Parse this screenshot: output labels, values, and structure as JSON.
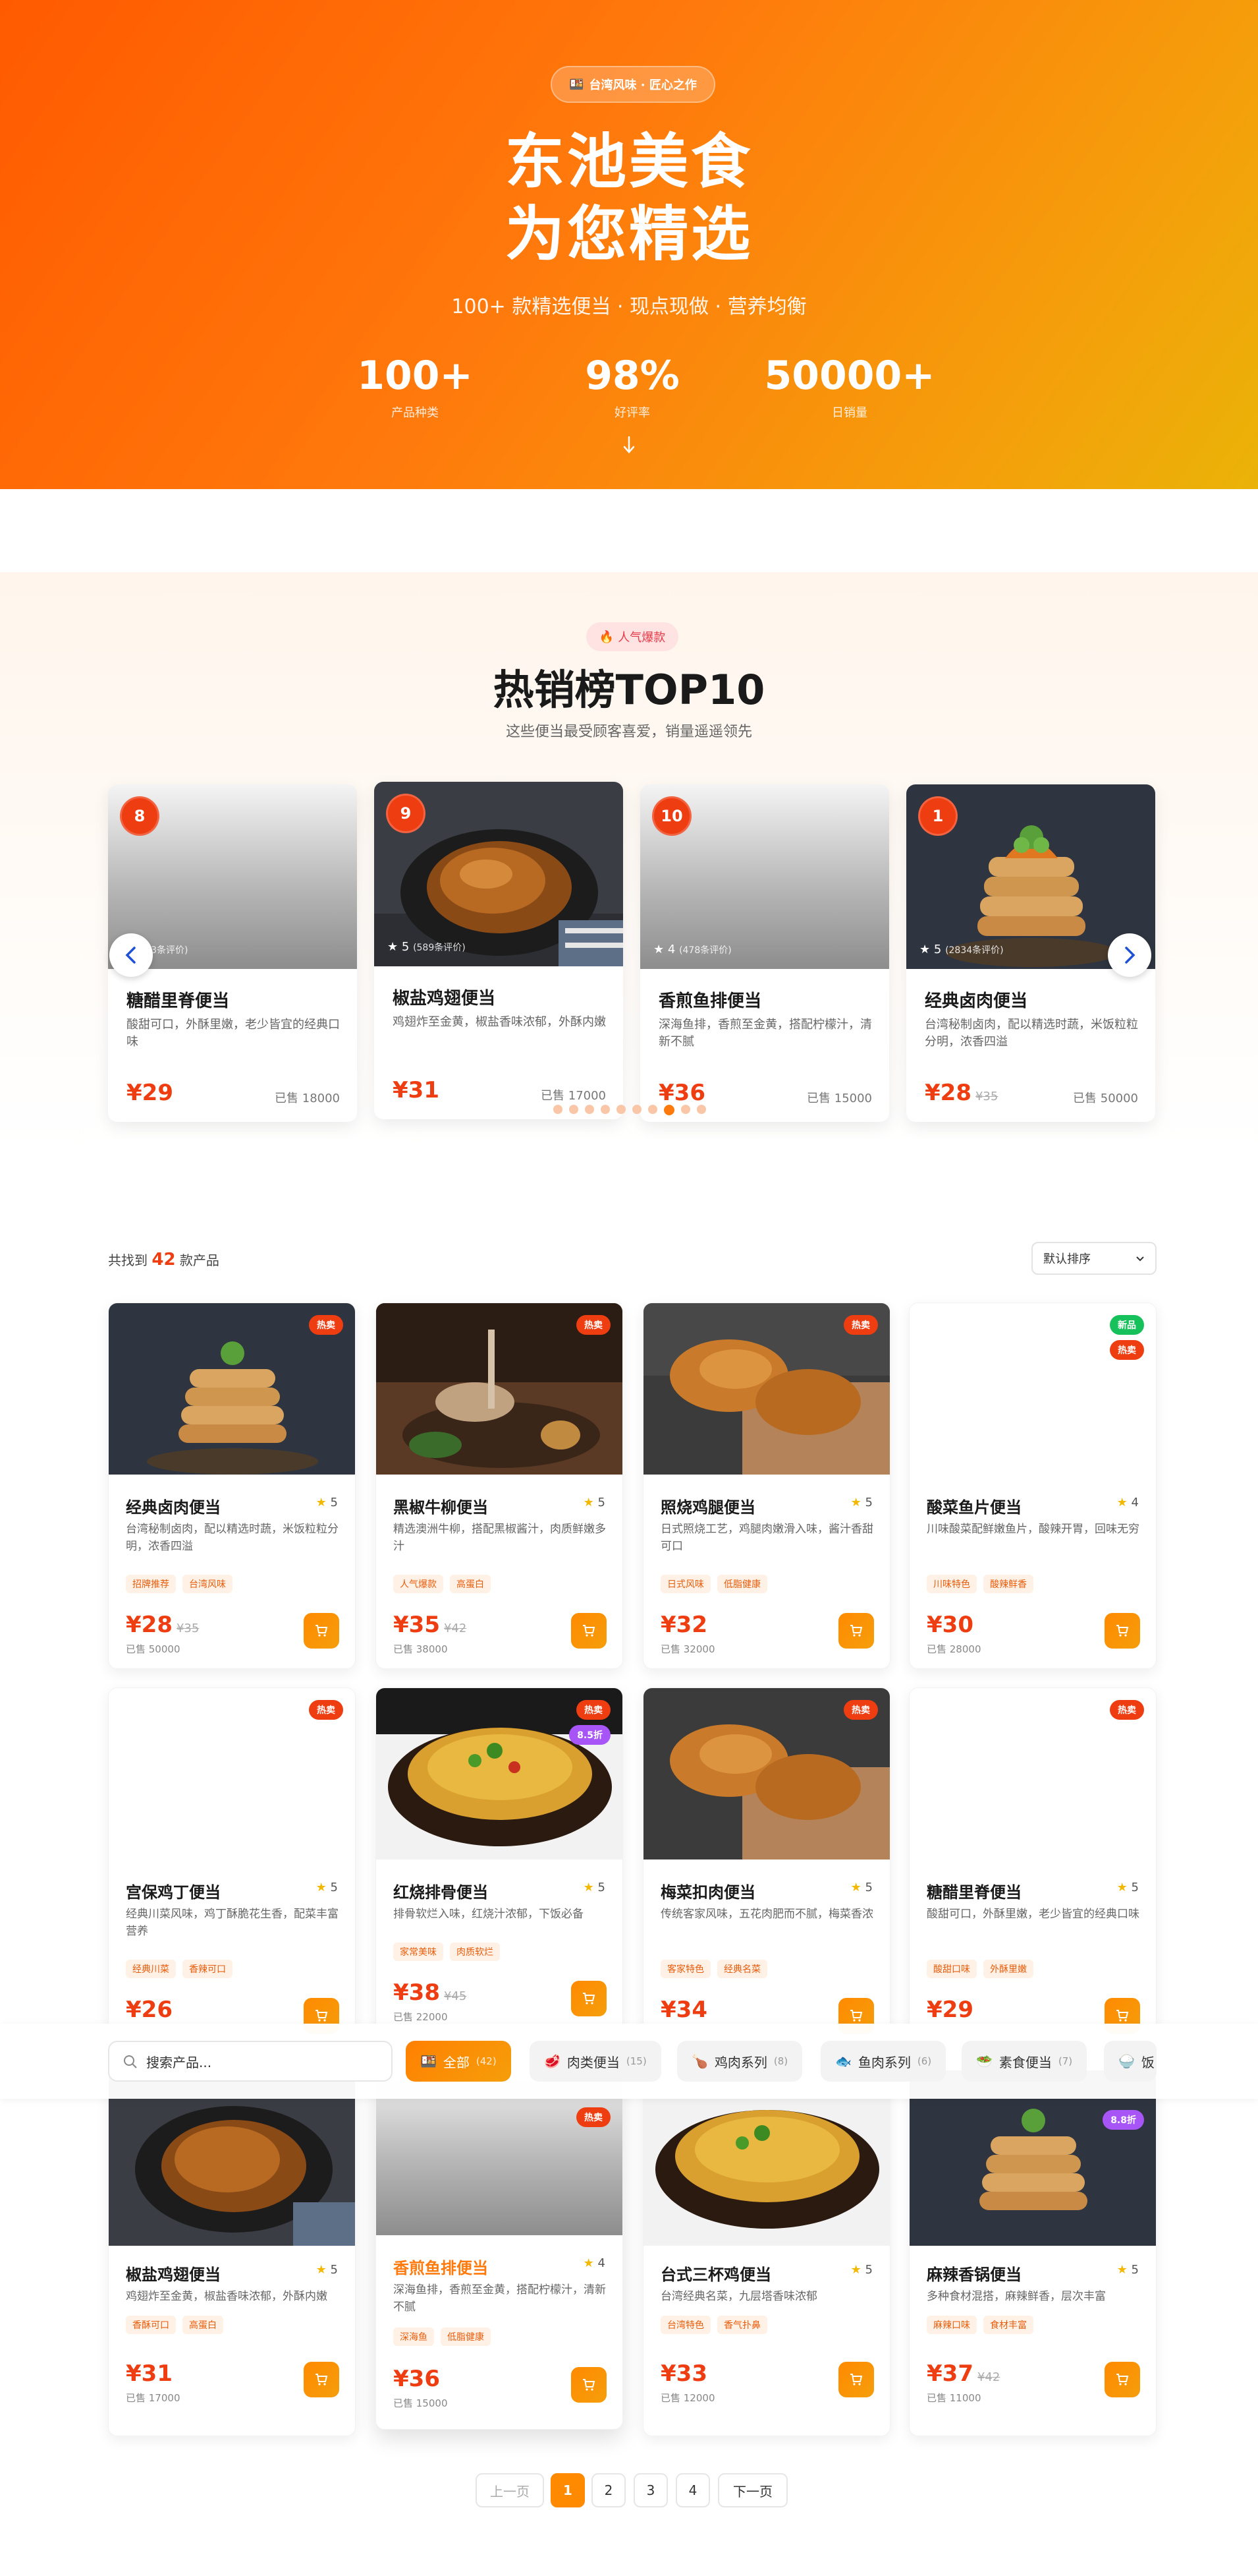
{
  "hero": {
    "badge": "台湾风味 · 匠心之作",
    "title_line1": "东池美食",
    "title_line2": "为您精选",
    "subtitle": "100+ 款精选便当 · 现点现做 · 营养均衡",
    "stats": [
      {
        "value": "100+",
        "label": "产品种类"
      },
      {
        "value": "98%",
        "label": "好评率"
      },
      {
        "value": "50000+",
        "label": "日销量"
      }
    ]
  },
  "hot": {
    "badge": "人气爆款",
    "title": "热销榜TOP10",
    "subtitle": "这些便当最受顾客喜爱，销量遥遥领先",
    "cards": [
      {
        "rank": "8",
        "rating": "",
        "reviews": "(623条评价)",
        "name": "糖醋里脊便当",
        "desc": "酸甜可口，外酥里嫩，老少皆宜的经典口味",
        "price": "¥29",
        "old": "",
        "sold": "已售 18000"
      },
      {
        "rank": "9",
        "rating": "5",
        "reviews": "(589条评价)",
        "name": "椒盐鸡翅便当",
        "desc": "鸡翅炸至金黄，椒盐香味浓郁，外酥内嫩",
        "price": "¥31",
        "old": "",
        "sold": "已售 17000"
      },
      {
        "rank": "10",
        "rating": "4",
        "reviews": "(478条评价)",
        "name": "香煎鱼排便当",
        "desc": "深海鱼排，香煎至金黄，搭配柠檬汁，清新不腻",
        "price": "¥36",
        "old": "",
        "sold": "已售 15000"
      },
      {
        "rank": "1",
        "rating": "5",
        "reviews": "(2834条评价)",
        "name": "经典卤肉便当",
        "desc": "台湾秘制卤肉，配以精选时蔬，米饭粒粒分明，浓香四溢",
        "price": "¥28",
        "old": "¥35",
        "sold": "已售 50000"
      }
    ]
  },
  "products": {
    "found_prefix": "共找到",
    "found_count": "42",
    "found_suffix": "款产品",
    "sort_label": "默认排序",
    "cards": [
      {
        "name": "经典卤肉便当",
        "rating": "5",
        "desc": "台湾秘制卤肉，配以精选时蔬，米饭粒粒分明，浓香四溢",
        "tags": [
          "招牌推荐",
          "台湾风味"
        ],
        "price": "¥28",
        "old": "¥35",
        "sold": "已售 50000",
        "badges": [
          "热卖"
        ]
      },
      {
        "name": "黑椒牛柳便当",
        "rating": "5",
        "desc": "精选澳洲牛柳，搭配黑椒酱汁，肉质鲜嫩多汁",
        "tags": [
          "人气爆款",
          "高蛋白"
        ],
        "price": "¥35",
        "old": "¥42",
        "sold": "已售 38000",
        "badges": [
          "热卖"
        ]
      },
      {
        "name": "照烧鸡腿便当",
        "rating": "5",
        "desc": "日式照烧工艺，鸡腿肉嫩滑入味，酱汁香甜可口",
        "tags": [
          "日式风味",
          "低脂健康"
        ],
        "price": "¥32",
        "old": "",
        "sold": "已售 32000",
        "badges": [
          "热卖"
        ]
      },
      {
        "name": "酸菜鱼片便当",
        "rating": "4",
        "desc": "川味酸菜配鲜嫩鱼片，酸辣开胃，回味无穷",
        "tags": [
          "川味特色",
          "酸辣鲜香"
        ],
        "price": "¥30",
        "old": "",
        "sold": "已售 28000",
        "badges": [
          "新品",
          "热卖"
        ]
      },
      {
        "name": "宫保鸡丁便当",
        "rating": "5",
        "desc": "经典川菜风味，鸡丁酥脆花生香，配菜丰富营养",
        "tags": [
          "经典川菜",
          "香辣可口"
        ],
        "price": "¥26",
        "old": "",
        "sold": "",
        "badges": [
          "热卖"
        ]
      },
      {
        "name": "红烧排骨便当",
        "rating": "5",
        "desc": "排骨软烂入味，红烧汁浓郁，下饭必备",
        "tags": [
          "家常美味",
          "肉质软烂"
        ],
        "price": "¥38",
        "old": "¥45",
        "sold": "已售 22000",
        "badges": [
          "热卖",
          "8.5折"
        ]
      },
      {
        "name": "梅菜扣肉便当",
        "rating": "5",
        "desc": "传统客家风味，五花肉肥而不腻，梅菜香浓",
        "tags": [
          "客家特色",
          "经典名菜"
        ],
        "price": "¥34",
        "old": "",
        "sold": "",
        "badges": [
          "热卖"
        ]
      },
      {
        "name": "糖醋里脊便当",
        "rating": "5",
        "desc": "酸甜可口，外酥里嫩，老少皆宜的经典口味",
        "tags": [
          "酸甜口味",
          "外酥里嫩"
        ],
        "price": "¥29",
        "old": "",
        "sold": "",
        "badges": [
          "热卖"
        ]
      },
      {
        "name": "椒盐鸡翅便当",
        "rating": "5",
        "desc": "鸡翅炸至金黄，椒盐香味浓郁，外酥内嫩",
        "tags": [
          "香酥可口",
          "高蛋白"
        ],
        "price": "¥31",
        "old": "",
        "sold": "已售 17000",
        "badges": []
      },
      {
        "name": "香煎鱼排便当",
        "rating": "4",
        "desc": "深海鱼排，香煎至金黄，搭配柠檬汁，清新不腻",
        "tags": [
          "深海鱼",
          "低脂健康"
        ],
        "price": "¥36",
        "old": "",
        "sold": "已售 15000",
        "badges": [
          "热卖"
        ]
      },
      {
        "name": "台式三杯鸡便当",
        "rating": "5",
        "desc": "台湾经典名菜，九层塔香味浓郁",
        "tags": [
          "台湾特色",
          "香气扑鼻"
        ],
        "price": "¥33",
        "old": "",
        "sold": "已售 12000",
        "badges": []
      },
      {
        "name": "麻辣香锅便当",
        "rating": "5",
        "desc": "多种食材混搭，麻辣鲜香，层次丰富",
        "tags": [
          "麻辣口味",
          "食材丰富"
        ],
        "price": "¥37",
        "old": "¥42",
        "sold": "已售 11000",
        "badges": [
          "8.8折"
        ]
      }
    ]
  },
  "filter": {
    "search_placeholder": "搜索产品...",
    "chips": [
      {
        "label": "全部",
        "count": "(42)",
        "icon": "bento-icon"
      },
      {
        "label": "肉类便当",
        "count": "(15)",
        "icon": "meat-icon"
      },
      {
        "label": "鸡肉系列",
        "count": "(8)",
        "icon": "drumstick-icon"
      },
      {
        "label": "鱼肉系列",
        "count": "(6)",
        "icon": "fish-icon"
      },
      {
        "label": "素食便当",
        "count": "(7)",
        "icon": "veggie-icon"
      },
      {
        "label": "饭",
        "count": "",
        "icon": "rice-icon"
      }
    ]
  },
  "pagination": {
    "prev": "上一页",
    "pages": [
      "1",
      "2",
      "3",
      "4"
    ],
    "next": "下一页",
    "current": "1"
  },
  "colors": {
    "brand": "#ff7a0c",
    "accent_red": "#ef3d12",
    "hot_badge": "#ef3d12",
    "new_badge": "#16c05a",
    "discount_badge": "#a855f7"
  }
}
